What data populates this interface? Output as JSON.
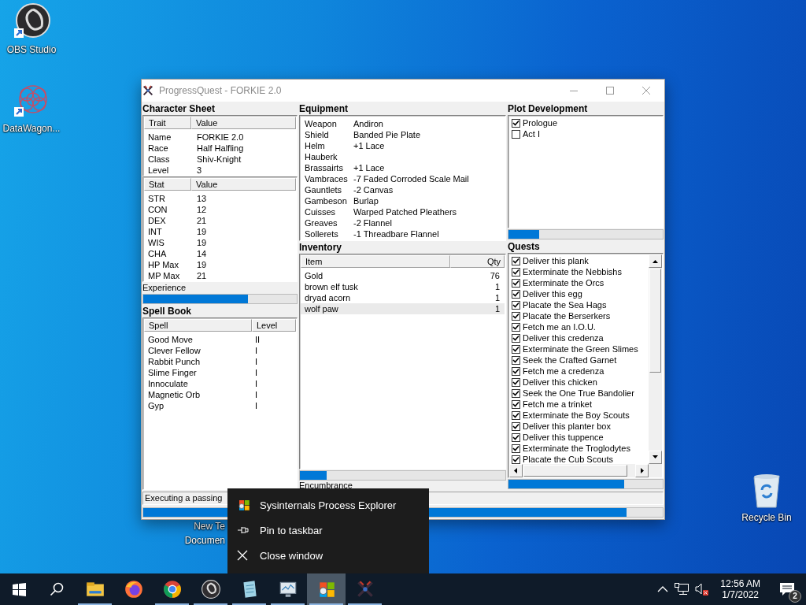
{
  "desktop_icons": [
    {
      "label_lines": [
        "OBS Studio"
      ],
      "kind": "obs"
    },
    {
      "label_lines": [
        "DataWagon..."
      ],
      "kind": "datawagon"
    },
    {
      "label_lines": [
        "New Te",
        "Documen"
      ],
      "kind": "document"
    },
    {
      "label_lines": [
        "Recycle Bin"
      ],
      "kind": "recycle"
    }
  ],
  "window": {
    "title": "ProgressQuest - FORKIE 2.0",
    "character_sheet": {
      "title": "Character Sheet",
      "columns": [
        "Trait",
        "Value"
      ],
      "rows": [
        [
          "Name",
          "FORKIE 2.0"
        ],
        [
          "Race",
          "Half Halfling"
        ],
        [
          "Class",
          "Shiv-Knight"
        ],
        [
          "Level",
          "3"
        ]
      ]
    },
    "stats": {
      "columns": [
        "Stat",
        "Value"
      ],
      "rows": [
        [
          "STR",
          "13"
        ],
        [
          "CON",
          "12"
        ],
        [
          "DEX",
          "21"
        ],
        [
          "INT",
          "19"
        ],
        [
          "WIS",
          "19"
        ],
        [
          "CHA",
          "14"
        ],
        [
          "HP Max",
          "19"
        ],
        [
          "MP Max",
          "21"
        ]
      ]
    },
    "experience": {
      "label": "Experience",
      "level": 0.68
    },
    "spell_book": {
      "title": "Spell Book",
      "columns": [
        "Spell",
        "Level"
      ],
      "rows": [
        [
          "Good Move",
          "II"
        ],
        [
          "Clever Fellow",
          "I"
        ],
        [
          "Rabbit Punch",
          "I"
        ],
        [
          "Slime Finger",
          "I"
        ],
        [
          "Innoculate",
          "I"
        ],
        [
          "Magnetic Orb",
          "I"
        ],
        [
          "Gyp",
          "I"
        ]
      ]
    },
    "equipment": {
      "title": "Equipment",
      "rows": [
        {
          "slot": "Weapon",
          "item": "Andiron"
        },
        {
          "slot": "Shield",
          "item": "Banded Pie Plate"
        },
        {
          "slot": "Helm",
          "item": "+1 Lace"
        },
        {
          "slot": "Hauberk"
        },
        {
          "slot": "Brassairts",
          "item": "+1 Lace"
        },
        {
          "slot": "Vambraces",
          "item": "-7 Faded Corroded Scale Mail"
        },
        {
          "slot": "Gauntlets",
          "item": "-2 Canvas"
        },
        {
          "slot": "Gambeson",
          "item": "Burlap"
        },
        {
          "slot": "Cuisses",
          "item": "Warped Patched Pleathers"
        },
        {
          "slot": "Greaves",
          "item": "-2 Flannel"
        },
        {
          "slot": "Sollerets",
          "item": "-1 Threadbare Flannel"
        }
      ]
    },
    "inventory": {
      "title": "Inventory",
      "columns": [
        "Item",
        "Qty"
      ],
      "rows": [
        {
          "item": "Gold",
          "qty": "76",
          "selected": false
        },
        {
          "item": "brown elf tusk",
          "qty": "1",
          "selected": false
        },
        {
          "item": "dryad acorn",
          "qty": "1",
          "selected": false
        },
        {
          "item": "wolf paw",
          "qty": "1",
          "selected": true
        }
      ]
    },
    "inventory_bar": {
      "level": 0.13
    },
    "encumbrance_label": "Encumbrance",
    "plot": {
      "title": "Plot Development",
      "items": [
        {
          "label": "Prologue",
          "checked": true
        },
        {
          "label": "Act I",
          "checked": false
        }
      ]
    },
    "plot_bar": {
      "level": 0.2
    },
    "quests": {
      "title": "Quests",
      "items": [
        {
          "label": "Deliver this plank",
          "checked": true
        },
        {
          "label": "Exterminate the Nebbishs",
          "checked": true
        },
        {
          "label": "Exterminate the Orcs",
          "checked": true
        },
        {
          "label": "Deliver this egg",
          "checked": true
        },
        {
          "label": "Placate the Sea Hags",
          "checked": true
        },
        {
          "label": "Placate the Berserkers",
          "checked": true
        },
        {
          "label": "Fetch me an I.O.U.",
          "checked": true
        },
        {
          "label": "Deliver this credenza",
          "checked": true
        },
        {
          "label": "Exterminate the Green Slimes",
          "checked": true
        },
        {
          "label": "Seek the Crafted Garnet",
          "checked": true
        },
        {
          "label": "Fetch me a credenza",
          "checked": true
        },
        {
          "label": "Deliver this chicken",
          "checked": true
        },
        {
          "label": "Seek the One True Bandolier",
          "checked": true
        },
        {
          "label": "Fetch me a trinket",
          "checked": true
        },
        {
          "label": "Exterminate the Boy Scouts",
          "checked": true
        },
        {
          "label": "Deliver this planter box",
          "checked": true
        },
        {
          "label": "Deliver this tuppence",
          "checked": true
        },
        {
          "label": "Exterminate the Troglodytes",
          "checked": true
        },
        {
          "label": "Placate the Cub Scouts",
          "checked": true
        }
      ]
    },
    "quests_bar": {
      "level": 0.75
    },
    "status": "Executing a passing",
    "task_bar": {
      "level": 0.93
    }
  },
  "context_menu": {
    "items": [
      {
        "label": "Sysinternals Process Explorer",
        "kind": "app"
      },
      {
        "label": "Pin to taskbar",
        "kind": "pin"
      },
      {
        "label": "Close window",
        "kind": "close"
      }
    ]
  },
  "taskbar": {
    "apps": [
      {
        "kind": "explorer",
        "running": true,
        "selected": false
      },
      {
        "kind": "firefox",
        "running": false,
        "selected": false
      },
      {
        "kind": "chrome",
        "running": true,
        "selected": false
      },
      {
        "kind": "obs",
        "running": true,
        "selected": false
      },
      {
        "kind": "notepad",
        "running": true,
        "selected": false
      },
      {
        "kind": "monitor",
        "running": true,
        "selected": false
      },
      {
        "kind": "procexp",
        "running": true,
        "selected": true
      },
      {
        "kind": "progressquest",
        "running": true,
        "selected": false
      }
    ],
    "clock": {
      "time": "12:56 AM",
      "date": "1/7/2022"
    },
    "notification_count": "2"
  }
}
